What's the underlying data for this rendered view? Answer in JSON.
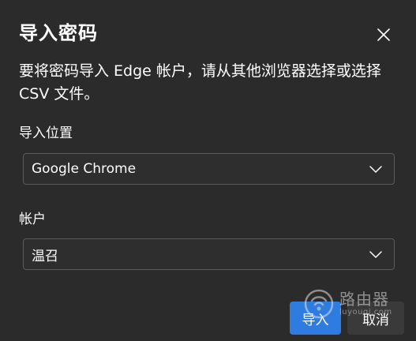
{
  "dialog": {
    "title": "导入密码",
    "description": "要将密码导入 Edge 帐户，请从其他浏览器选择或选择 CSV 文件。",
    "close_icon": "close-icon"
  },
  "import_source": {
    "label": "导入位置",
    "selected": "Google Chrome",
    "icon": "chevron-down-icon"
  },
  "account": {
    "label": "帐户",
    "selected": "温召",
    "icon": "chevron-down-icon"
  },
  "buttons": {
    "import_label": "导入",
    "cancel_label": "取消"
  },
  "watermark": {
    "title": "路由器",
    "subtitle": "luyouqi.com",
    "icon": "router-logo-icon"
  },
  "colors": {
    "background": "#2b2b2b",
    "accent": "#2f7ce0",
    "border": "#5c5c5c"
  }
}
